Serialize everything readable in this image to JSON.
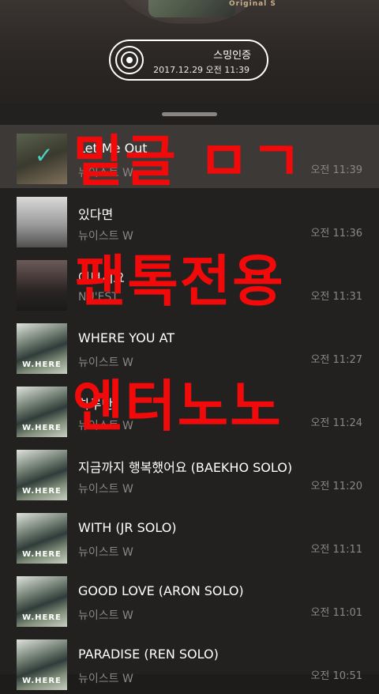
{
  "header": {
    "album_caption": "Original S",
    "badge": {
      "title": "스밍인증",
      "datetime": "2017.12.29 오전 11:39"
    }
  },
  "songs": [
    {
      "title": "Let Me Out",
      "artist": "뉴이스트 W",
      "time": "오전 11:39",
      "active": true
    },
    {
      "title": "있다면",
      "artist": "뉴이스트 W",
      "time": "오전 11:36"
    },
    {
      "title": "여보세요",
      "artist": "NU'EST",
      "time": "오전 11:31"
    },
    {
      "title": "WHERE YOU AT",
      "artist": "뉴이스트 W",
      "time": "오전 11:27"
    },
    {
      "title": "하루만",
      "artist": "뉴이스트 W",
      "time": "오전 11:24"
    },
    {
      "title": "지금까지 행복했어요 (BAEKHO SOLO)",
      "artist": "뉴이스트 W",
      "time": "오전 11:20"
    },
    {
      "title": "WITH (JR SOLO)",
      "artist": "뉴이스트 W",
      "time": "오전 11:11"
    },
    {
      "title": "GOOD LOVE (ARON SOLO)",
      "artist": "뉴이스트 W",
      "time": "오전 11:01"
    },
    {
      "title": "PARADISE (REN SOLO)",
      "artist": "뉴이스트 W",
      "time": "오전 10:51"
    }
  ],
  "album_art_text": "W.HERE",
  "overlay": {
    "line1": "밑글 ㅁㄱ",
    "line2": "팬톡전용",
    "line3": "엔터노노"
  },
  "colors": {
    "overlay_red": "#f20a0a",
    "check_teal": "#4ad3c2",
    "panel_bg": "#232120"
  }
}
